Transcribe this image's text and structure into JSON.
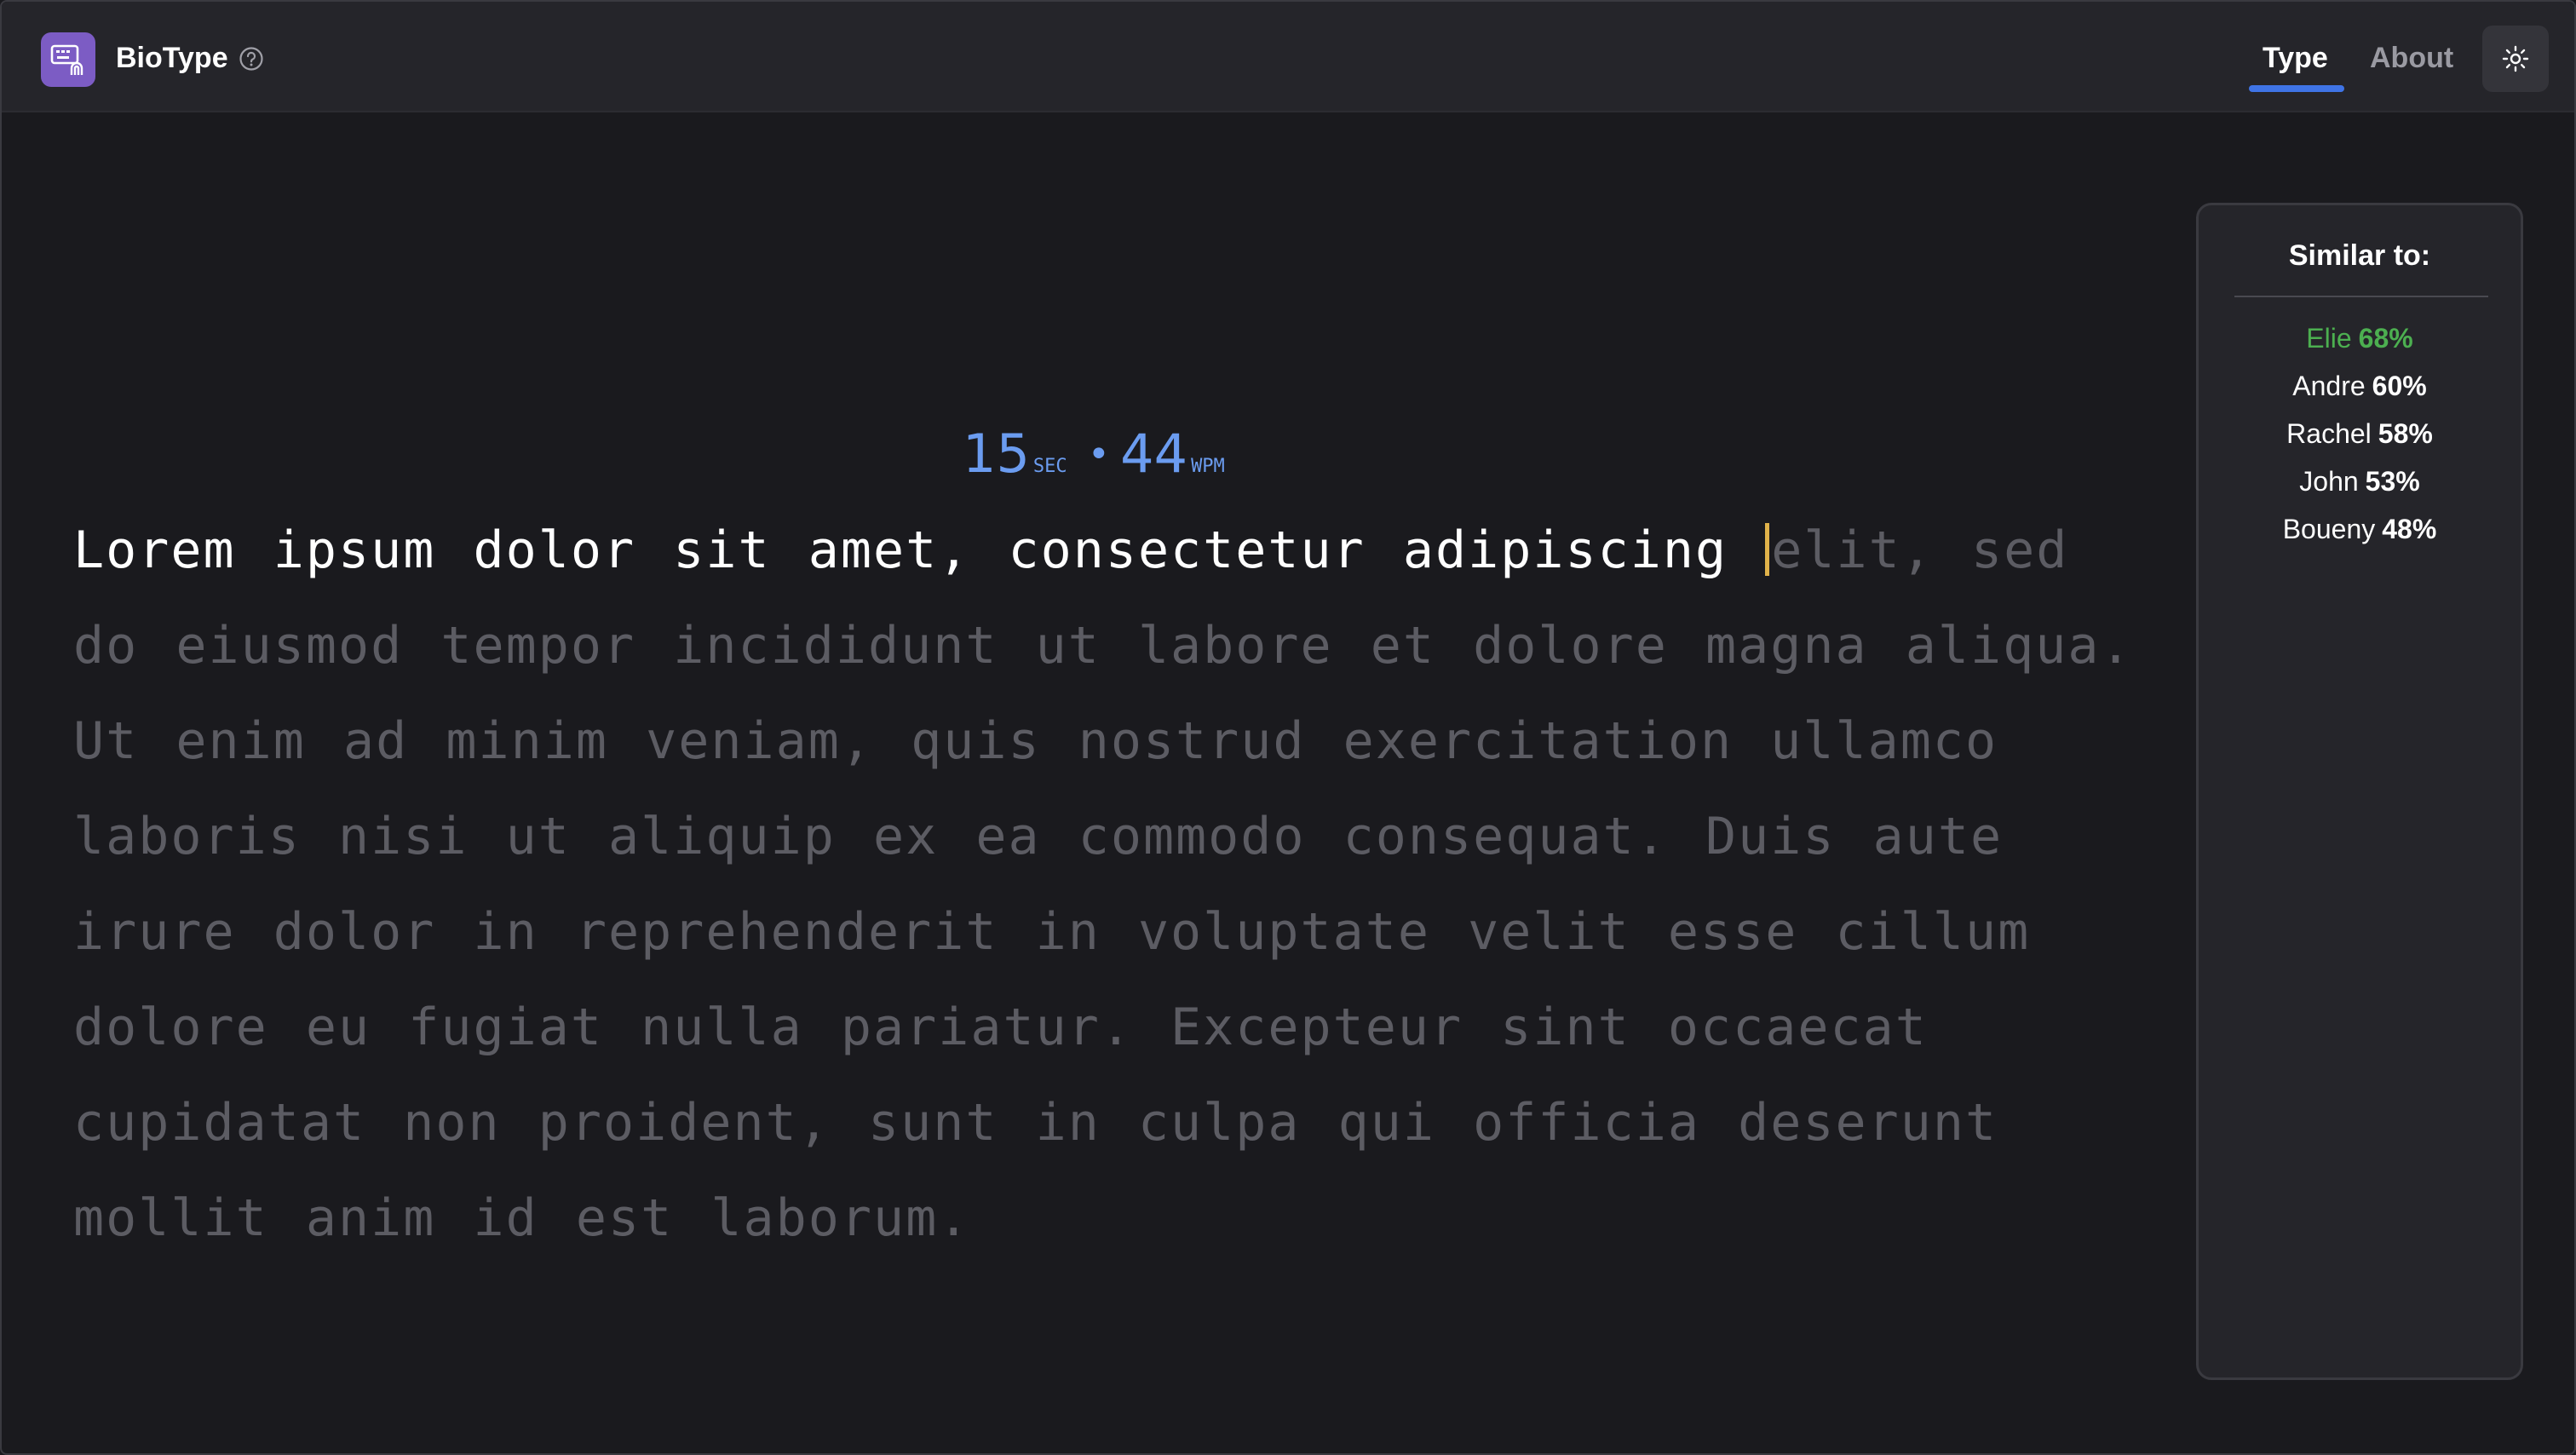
{
  "header": {
    "app_name": "BioType",
    "logo_icon": "keyboard-fingerprint-icon",
    "help_icon": "question-circle-icon",
    "tabs": [
      {
        "label": "Type",
        "active": true
      },
      {
        "label": "About",
        "active": false
      }
    ],
    "theme_toggle_icon": "sun-icon",
    "accent_color": "#3f74e6",
    "logo_color": "#7c5cc4"
  },
  "stats": {
    "seconds": "15",
    "seconds_unit": "SEC",
    "separator": "•",
    "wpm": "44",
    "wpm_unit": "WPM",
    "color": "#6b9cf0"
  },
  "typing": {
    "typed_text": "Lorem ipsum dolor sit amet, consectetur adipiscing ",
    "remaining_text": "elit, sed do eiusmod tempor incididunt ut labore et dolore magna aliqua. Ut enim ad minim veniam, quis nostrud exercitation ullamco laboris nisi ut aliquip ex ea commodo consequat. Duis aute irure dolor in reprehenderit in voluptate velit esse cillum dolore eu fugiat nulla pariatur. Excepteur sint occaecat cupidatat non proident, sunt in culpa qui officia deserunt mollit anim id est laborum.",
    "caret_color": "#e0b24a"
  },
  "similar": {
    "title": "Similar to:",
    "items": [
      {
        "name": "Elie",
        "percent": "68%",
        "highlight": true,
        "color": "#4caf50"
      },
      {
        "name": "Andre",
        "percent": "60%",
        "highlight": false
      },
      {
        "name": "Rachel",
        "percent": "58%",
        "highlight": false
      },
      {
        "name": "John",
        "percent": "53%",
        "highlight": false
      },
      {
        "name": "Boueny",
        "percent": "48%",
        "highlight": false
      }
    ]
  }
}
